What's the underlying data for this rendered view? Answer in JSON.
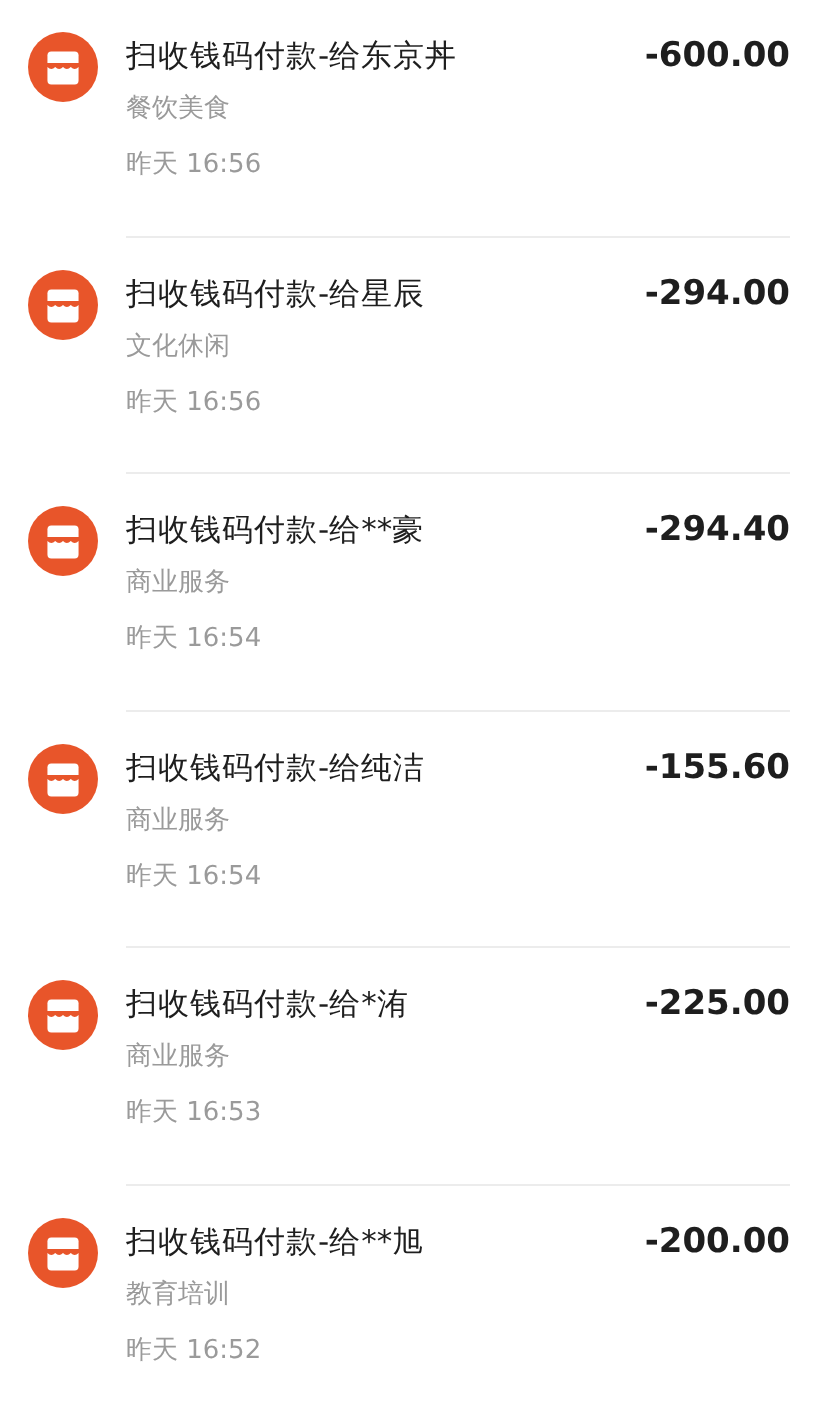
{
  "transactions": [
    {
      "title": "扫收钱码付款-给东京丼",
      "category": "餐饮美食",
      "time": "昨天 16:56",
      "amount": "-600.00"
    },
    {
      "title": "扫收钱码付款-给星辰",
      "category": "文化休闲",
      "time": "昨天 16:56",
      "amount": "-294.00"
    },
    {
      "title": "扫收钱码付款-给**豪",
      "category": "商业服务",
      "time": "昨天 16:54",
      "amount": "-294.40"
    },
    {
      "title": "扫收钱码付款-给纯洁",
      "category": "商业服务",
      "time": "昨天 16:54",
      "amount": "-155.60"
    },
    {
      "title": "扫收钱码付款-给*洧",
      "category": "商业服务",
      "time": "昨天 16:53",
      "amount": "-225.00"
    },
    {
      "title": "扫收钱码付款-给**旭",
      "category": "教育培训",
      "time": "昨天 16:52",
      "amount": "-200.00"
    }
  ]
}
